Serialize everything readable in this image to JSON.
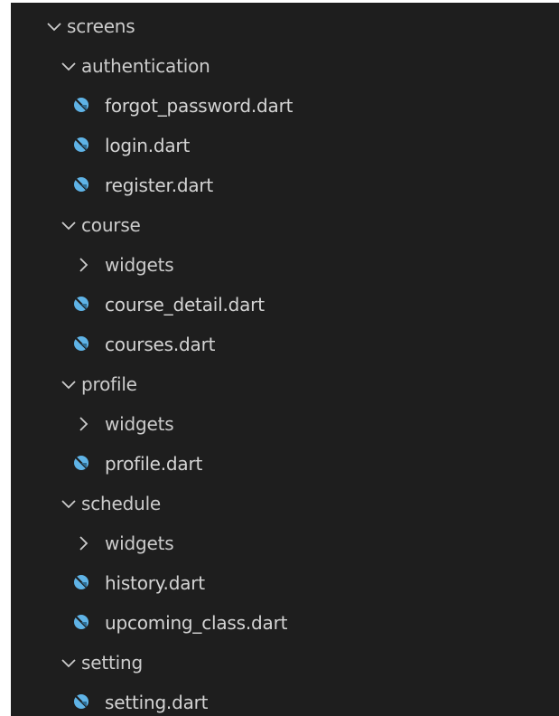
{
  "explorer": {
    "root": {
      "label": "screens",
      "icon": "chevron-down-icon"
    },
    "authentication": {
      "label": "authentication",
      "files": [
        "forgot_password.dart",
        "login.dart",
        "register.dart"
      ]
    },
    "course": {
      "label": "course",
      "widgets_label": "widgets",
      "files": [
        "course_detail.dart",
        "courses.dart"
      ]
    },
    "profile": {
      "label": "profile",
      "widgets_label": "widgets",
      "files": [
        "profile.dart"
      ]
    },
    "schedule": {
      "label": "schedule",
      "widgets_label": "widgets",
      "files": [
        "history.dart",
        "upcoming_class.dart"
      ]
    },
    "setting": {
      "label": "setting",
      "files": [
        "setting.dart"
      ]
    }
  },
  "colors": {
    "background": "#1e1e1e",
    "text": "#cccccc",
    "dart_icon": "#5fb3e6",
    "dart_icon_shadow": "#1e3a4a"
  }
}
